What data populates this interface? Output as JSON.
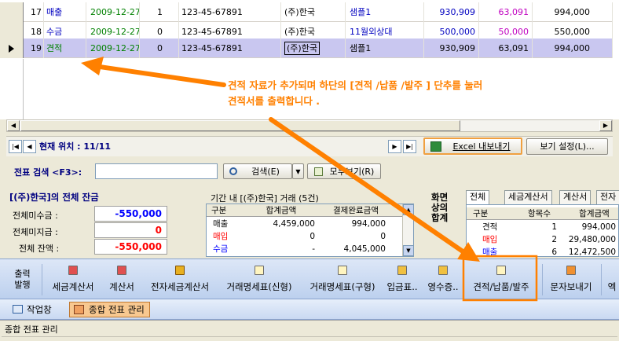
{
  "grid": {
    "rows": [
      {
        "no": "17",
        "type": "매출",
        "date": "2009-12-27",
        "flag": "1",
        "biz": "123-45-67891",
        "company": "(주)한국",
        "item": "샘플1",
        "amt1": "930,909",
        "amt2": "63,091",
        "amt3": "994,000"
      },
      {
        "no": "18",
        "type": "수금",
        "date": "2009-12-27",
        "flag": "0",
        "biz": "123-45-67891",
        "company": "(주)한국",
        "item": "11월외상대",
        "amt1": "500,000",
        "amt2": "50,000",
        "amt3": "550,000"
      },
      {
        "no": "19",
        "type": "견적",
        "date": "2009-12-27",
        "flag": "0",
        "biz": "123-45-67891",
        "company": "(주)한국",
        "item": "샘플1",
        "amt1": "930,909",
        "amt2": "63,091",
        "amt3": "994,000"
      }
    ]
  },
  "annotation": {
    "line1": "견적 자료가 추가되며 하단의 [견적 /납품 /발주 ] 단추를 눌러",
    "line2": "견적서를 출력합니다 ."
  },
  "nav": {
    "position_label": "현재 위치 : 11/11",
    "excel_label": "Excel 내보내기",
    "view_settings_label": "보기 설정(L)..."
  },
  "search": {
    "label": "전표 검색 <F3>:",
    "value": "",
    "search_button": "검색(E)",
    "show_all_button": "모두보기(R)"
  },
  "balance": {
    "title": "[(주)한국]의 전체 잔금",
    "receivable_label": "전체미수금 :",
    "receivable_value": "-550,000",
    "payable_label": "전체미지급 :",
    "payable_value": "0",
    "total_label": "전체 잔액 :",
    "total_value": "-550,000"
  },
  "period": {
    "title": "기간 내 [(주)한국] 거래 (5건)",
    "headers": [
      "구분",
      "합계금액",
      "결제완료금액"
    ],
    "rows": [
      {
        "type": "매출",
        "total": "4,459,000",
        "settled": "994,000"
      },
      {
        "type": "매입",
        "total": "0",
        "settled": "0"
      },
      {
        "type": "수금",
        "total": "-",
        "settled": "4,045,000"
      }
    ]
  },
  "screen_summary": {
    "label_lines": [
      "화면",
      "상의",
      "합계"
    ],
    "tabs": [
      "전체",
      "세금계산서",
      "계산서",
      "전자"
    ],
    "headers": [
      "구분",
      "항목수",
      "합계금액"
    ],
    "rows": [
      {
        "type": "견적",
        "count": "1",
        "total": "994,000"
      },
      {
        "type": "매입",
        "count": "2",
        "total": "29,480,000"
      },
      {
        "type": "매출",
        "count": "6",
        "total": "12,472,500"
      }
    ]
  },
  "toolbar": {
    "print_label_lines": [
      "출력",
      "발행"
    ],
    "items": [
      {
        "label": "세금계산서"
      },
      {
        "label": "계산서"
      },
      {
        "label": "전자세금계산서"
      },
      {
        "label": "거래명세표(신형)"
      },
      {
        "label": "거래명세표(구형)"
      },
      {
        "label": "입금표.."
      },
      {
        "label": "영수증.."
      },
      {
        "label": "견적/납품/발주"
      },
      {
        "label": "문자보내기"
      },
      {
        "label": "엑"
      }
    ]
  },
  "taskbar": {
    "items": [
      {
        "label": "작업창"
      },
      {
        "label": "종합 전표 관리"
      }
    ]
  },
  "status": {
    "text": "종합 전표 관리"
  },
  "colors": {
    "annotation": "#ff8000",
    "selected_row": "#c9c7f0",
    "negative": "#0000ff",
    "zero_red": "#ff0000",
    "toolbar": "#c6d6f0"
  }
}
